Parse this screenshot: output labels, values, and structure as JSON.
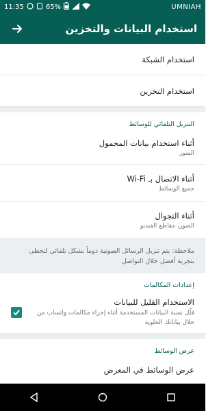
{
  "status_bar": {
    "time": "11:35",
    "battery": "65%",
    "carrier": "UMNIAH"
  },
  "app_bar": {
    "title": "استخدام البيانات والتخزين"
  },
  "usage": {
    "network_usage": "استخدام الشبكة",
    "storage_usage": "استخدام التخزين"
  },
  "auto_download": {
    "header": "التنزيل التلقائي للوسائط",
    "items": [
      {
        "title": "أثناء استخدام بيانات المحمول",
        "subtitle": "الصور"
      },
      {
        "title": "أثناء الاتصال بـ Wi-Fi",
        "subtitle": "جميع الوسائط"
      },
      {
        "title": "أثناء التجوال",
        "subtitle": "الصور، مقاطع الفيديو"
      }
    ],
    "note": "ملاحظة: يتم تنزيل الرسائل الصوتية دوماً بشكل تلقائي لتحظى بتجربة أفضل خلال التواصل"
  },
  "call_settings": {
    "header": "إعدادات المكالمات",
    "low_data_title": "الاستخدام القليل للبيانات",
    "low_data_desc": "قلّل نسبة البيانات المستخدمة أثناء إجراء مكالمات واتساب من خلال بياناتك الخلوية",
    "low_data_checked": true
  },
  "media_display": {
    "header": "عرض الوسائط",
    "show_in_gallery": "عرض الوسائط في المعرض"
  },
  "colors": {
    "primary": "#075e54",
    "accent": "#128c7e"
  }
}
